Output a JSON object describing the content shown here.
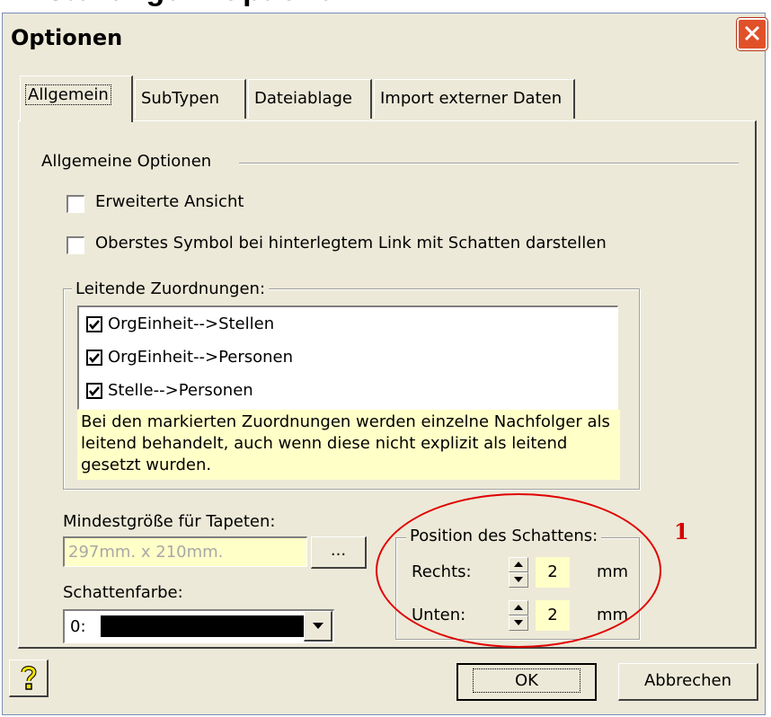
{
  "heading_fragment": "Einstellungen: Optionen",
  "dialog": {
    "title": "Optionen",
    "close_icon": "close-icon"
  },
  "tabs": [
    {
      "label": "Allgemein",
      "active": true
    },
    {
      "label": "SubTypen",
      "active": false
    },
    {
      "label": "Dateiablage",
      "active": false
    },
    {
      "label": "Import externer Daten",
      "active": false
    }
  ],
  "general": {
    "section_label": "Allgemeine Optionen",
    "extended_view": {
      "label": "Erweiterte Ansicht",
      "checked": false
    },
    "top_symbol_shadow": {
      "label": "Oberstes Symbol bei hinterlegtem Link mit Schatten darstellen",
      "checked": false
    }
  },
  "leading_assignments": {
    "legend": "Leitende Zuordnungen:",
    "items": [
      {
        "label": "OrgEinheit-->Stellen",
        "checked": true
      },
      {
        "label": "OrgEinheit-->Personen",
        "checked": true
      },
      {
        "label": "Stelle-->Personen",
        "checked": true
      }
    ],
    "note": "Bei den markierten Zuordnungen werden einzelne Nachfolger als leitend behandelt, auch wenn diese nicht explizit als leitend gesetzt wurden."
  },
  "wallpaper": {
    "label": "Mindestgröße für Tapeten:",
    "value": "297mm. x 210mm.",
    "browse_label": "..."
  },
  "shadow_color": {
    "label": "Schattenfarbe:",
    "value": "0:",
    "swatch_color": "#000000",
    "dropdown_icon": "chevron-down-icon"
  },
  "shadow_position": {
    "legend": "Position des Schattens:",
    "right_label": "Rechts:",
    "right_value": "2",
    "bottom_label": "Unten:",
    "bottom_value": "2",
    "unit": "mm"
  },
  "footer": {
    "help_icon": "question-icon",
    "ok_label": "OK",
    "cancel_label": "Abbrechen"
  },
  "annotation": {
    "number": "1",
    "color": "#e00000"
  },
  "colors": {
    "dialog_bg": "#ece9d8",
    "field_bg": "#ffffc8",
    "close_button": "#e0512a"
  }
}
